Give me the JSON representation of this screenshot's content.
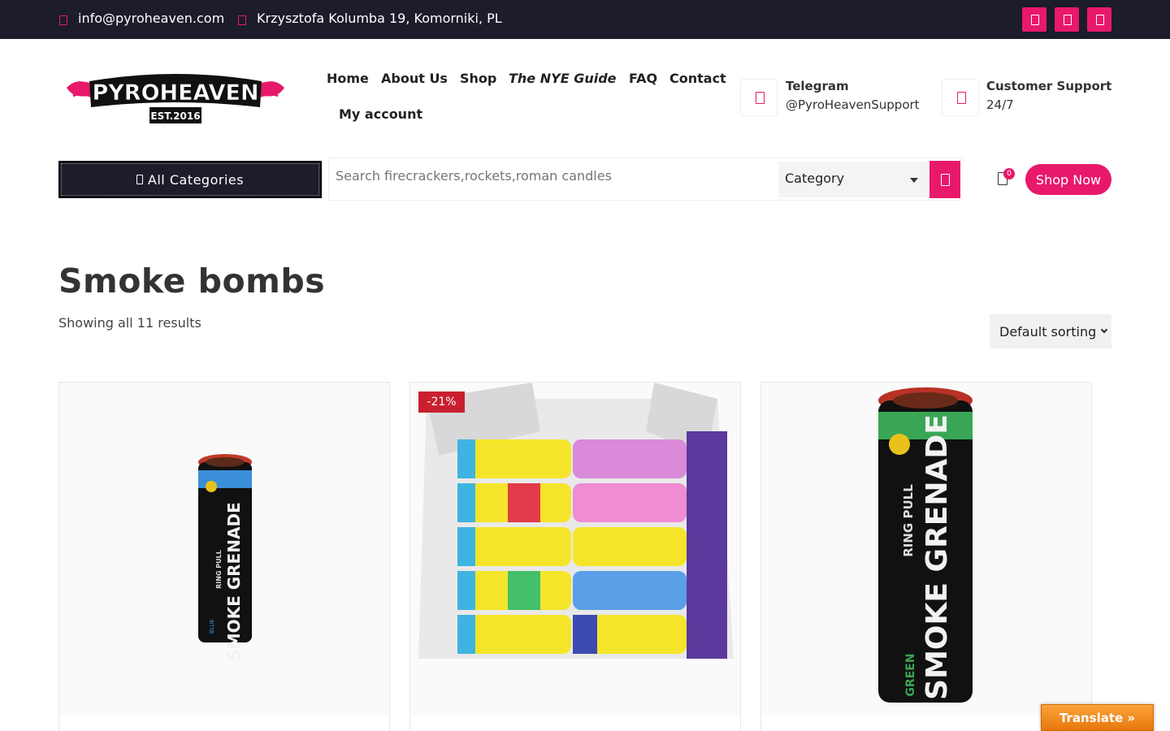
{
  "topbar": {
    "email": "info@pyroheaven.com",
    "address": "Krzysztofa Kolumba 19, Komorniki, PL",
    "social_icons": [
      "facebook-icon",
      "instagram-icon",
      "telegram-icon"
    ]
  },
  "header": {
    "logo_text": "PYROHEAVEN",
    "logo_sub": "EST.2016",
    "nav": [
      "Home",
      "About Us",
      "Shop",
      "The NYE Guide",
      "FAQ",
      "Contact",
      "My account"
    ],
    "telegram_title": "Telegram",
    "telegram_handle": "@PyroHeavenSupport",
    "support_title": "Customer Support",
    "support_hours": "24/7"
  },
  "search": {
    "categories_button": "All Categories",
    "placeholder": "Search firecrackers,rockets,roman candles",
    "category_select": "Category",
    "cart_count": "0",
    "shop_now": "Shop Now"
  },
  "main": {
    "title": "Smoke bombs",
    "result_count": "Showing all 11 results",
    "sorting": "Default sorting",
    "products": [
      {
        "badge": "",
        "image": "blue smoke grenade",
        "grenade_text": "SMOKE GRENADE",
        "ring_text": "RING PULL",
        "color_text": "BLUE"
      },
      {
        "badge": "-21%",
        "image": "box of colorful smoke bombs"
      },
      {
        "badge": "",
        "image": "green smoke grenade",
        "grenade_text": "SMOKE GRENADE",
        "ring_text": "RING PULL",
        "color_text": "GREEN"
      }
    ]
  },
  "translate": "Translate »",
  "colors": {
    "accent": "#e8196b",
    "dark": "#1c1c2a",
    "sale": "#c8202e"
  }
}
